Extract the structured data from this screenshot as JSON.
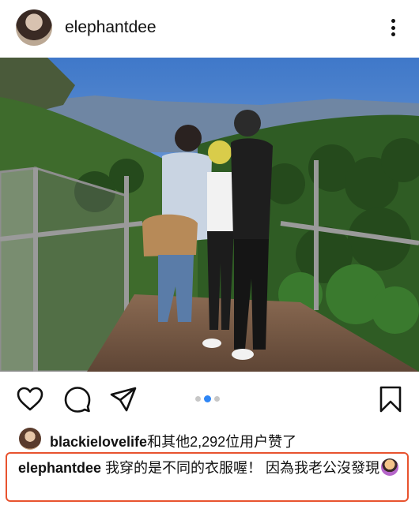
{
  "post": {
    "username": "elephantdee",
    "likes": {
      "first_liker": "blackielovelife",
      "rest": "和其他2,292位用户赞了"
    },
    "caption": {
      "username": "elephantdee",
      "text": " 我穿的是不同的衣服喔！ 因為我老公沒發現",
      "emoji": "person-shrugging-emoji"
    },
    "carousel": {
      "count": 3,
      "active_index": 1
    }
  },
  "colors": {
    "highlight_border": "#e8532f",
    "carousel_active": "#2f86f5",
    "carousel_inactive": "#c7c7c7"
  },
  "icons": [
    "more-vertical-icon",
    "heart-icon",
    "comment-icon",
    "share-icon",
    "bookmark-icon"
  ]
}
